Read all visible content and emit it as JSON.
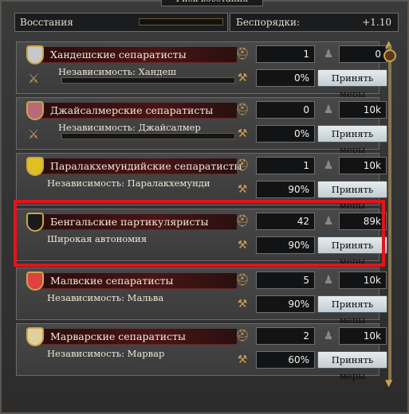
{
  "window": {
    "title": "Риск восстания"
  },
  "header": {
    "rebels_label": "Восстания",
    "unrest_label": "Беспорядки:",
    "unrest_value": "+1.10"
  },
  "rebels": [
    {
      "name": "Хандешские сепаратисты",
      "sub": "Независимость: Хандеш",
      "count": "1",
      "size": "0",
      "progress": "0%",
      "button": "Принять меры",
      "flag_color": "#c8c8c8"
    },
    {
      "name": "Джайсалмерские сепаратисты",
      "sub": "Независимость: Джайсалмер",
      "count": "0",
      "size": "10k",
      "progress": "0%",
      "button": "Принять меры",
      "flag_color": "#b86a7a"
    },
    {
      "name": "Паралакхемундийские сепаратисты",
      "sub": "Независимость: Паралакхемунди",
      "count": "1",
      "size": "10k",
      "progress": "90%",
      "button": "Принять меры",
      "flag_color": "#e0c020"
    },
    {
      "name": "Бенгальские партикуляристы",
      "sub": "Широкая автономия",
      "count": "42",
      "size": "89k",
      "progress": "90%",
      "button": "Принять меры",
      "flag_color": "#1a1a1a"
    },
    {
      "name": "Малвские сепаратисты",
      "sub": "Независимость: Мальва",
      "count": "5",
      "size": "10k",
      "progress": "90%",
      "button": "Принять меры",
      "flag_color": "#e04040"
    },
    {
      "name": "Марварские сепаратисты",
      "sub": "Независимость: Марвар",
      "count": "2",
      "size": "10k",
      "progress": "60%",
      "button": "Принять меры",
      "flag_color": "#e0d0a0"
    }
  ]
}
